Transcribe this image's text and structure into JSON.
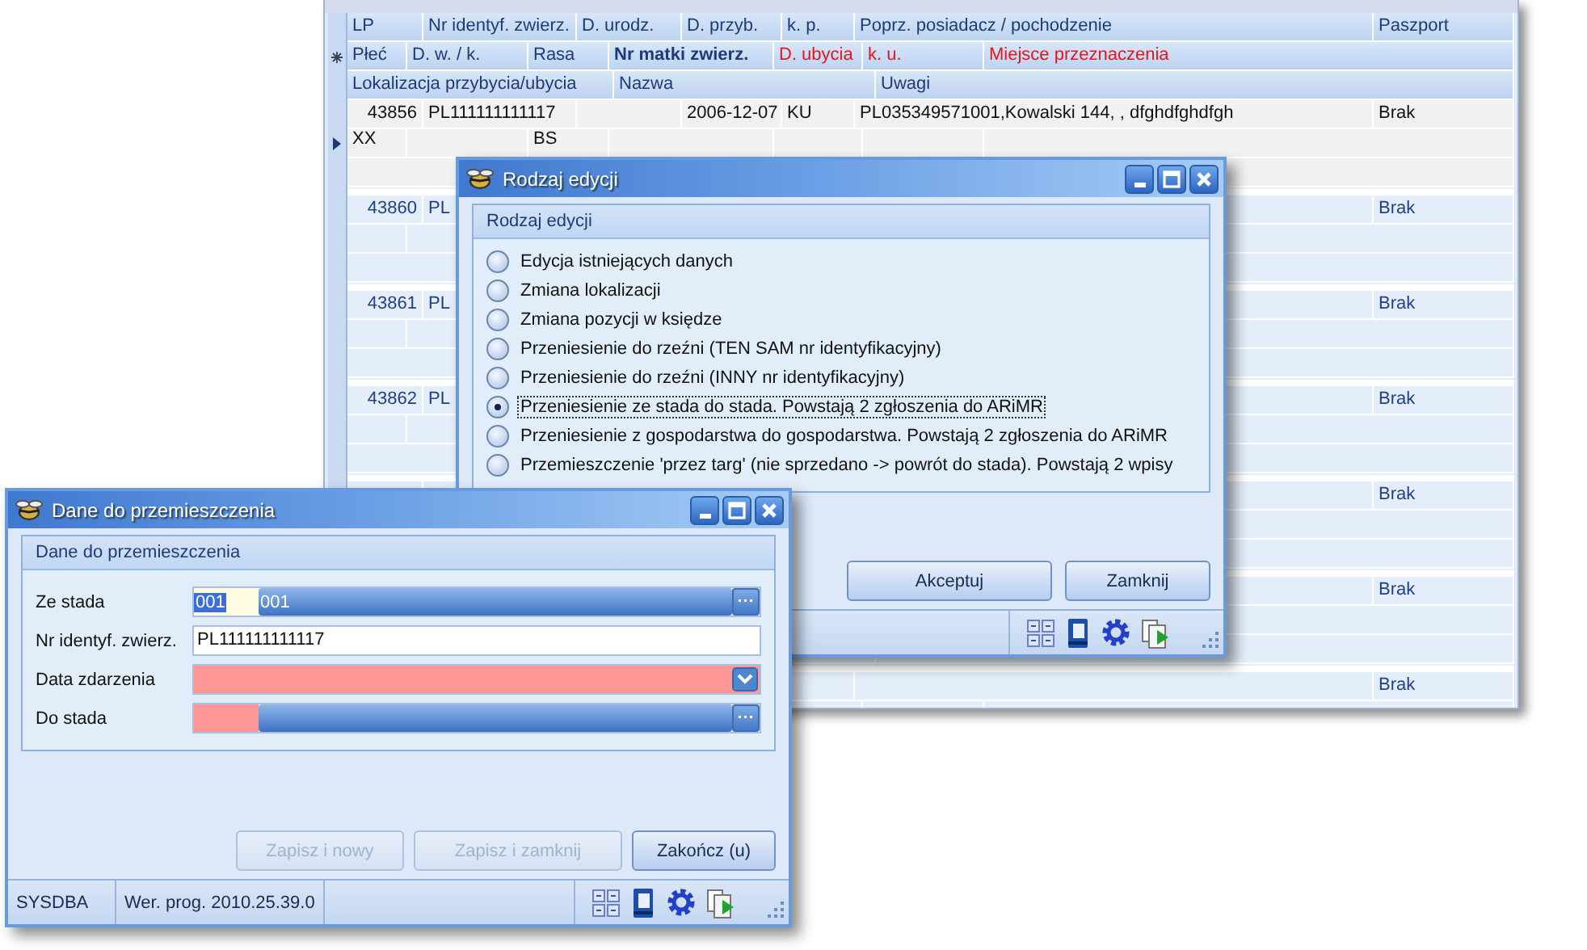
{
  "grid": {
    "header_rows": [
      [
        {
          "label": "LP",
          "kind": "normal"
        },
        {
          "label": "Nr identyf. zwierz.",
          "kind": "normal"
        },
        {
          "label": "D. urodz.",
          "kind": "normal"
        },
        {
          "label": "D. przyb.",
          "kind": "normal"
        },
        {
          "label": "k. p.",
          "kind": "normal"
        },
        {
          "label": "Poprz. posiadacz / pochodzenie",
          "kind": "normal"
        },
        {
          "label": "Paszport",
          "kind": "normal"
        }
      ],
      [
        {
          "label": "Płeć",
          "kind": "normal"
        },
        {
          "label": "D. w. / k.",
          "kind": "normal"
        },
        {
          "label": "Rasa",
          "kind": "normal"
        },
        {
          "label": "Nr matki zwierz.",
          "kind": "bold"
        },
        {
          "label": "D. ubycia",
          "kind": "red"
        },
        {
          "label": "k. u.",
          "kind": "red"
        },
        {
          "label": "Miejsce przeznaczenia",
          "kind": "red"
        }
      ],
      [
        {
          "label": "Lokalizacja przybycia/ubycia",
          "kind": "normal"
        },
        {
          "label": "Nazwa",
          "kind": "normal"
        },
        {
          "label": "Uwagi",
          "kind": "normal"
        }
      ]
    ],
    "records": [
      {
        "selected": true,
        "lp": "43856",
        "nr_identyf": "PL111111111117",
        "d_przyb": "2006-12-07",
        "kp": "KU",
        "poprz": "PL035349571001,Kowalski 144, , dfghdfghdfgh",
        "paszport": "Brak",
        "plec": "XX",
        "rasa": "BS"
      },
      {
        "selected": false,
        "lp": "43860",
        "nr_identyf": "PL",
        "paszport": "Brak"
      },
      {
        "selected": false,
        "lp": "43861",
        "nr_identyf": "PL",
        "paszport": "Brak"
      },
      {
        "selected": false,
        "lp": "43862",
        "nr_identyf": "PL",
        "paszport": "Brak"
      },
      {
        "selected": false,
        "paszport": "Brak"
      },
      {
        "selected": false,
        "paszport": "Brak"
      },
      {
        "selected": false,
        "paszport": "Brak"
      }
    ]
  },
  "edit_dialog": {
    "title": "Rodzaj edycji",
    "group_title": "Rodzaj edycji",
    "options": [
      {
        "label": "Edycja istniejących danych",
        "selected": false
      },
      {
        "label": "Zmiana lokalizacji",
        "selected": false
      },
      {
        "label": "Zmiana pozycji w księdze",
        "selected": false
      },
      {
        "label": "Przeniesienie do rzeźni (TEN SAM nr identyfikacyjny)",
        "selected": false
      },
      {
        "label": "Przeniesienie do rzeźni (INNY nr identyfikacyjny)",
        "selected": false
      },
      {
        "label": "Przeniesienie ze stada do stada. Powstają 2 zgłoszenia do ARiMR",
        "selected": true
      },
      {
        "label": "Przeniesienie z gospodarstwa do gospodarstwa. Powstają 2 zgłoszenia do ARiMR",
        "selected": false
      },
      {
        "label": "Przemieszczenie 'przez targ' (nie sprzedano -> powrót do stada). Powstają 2 wpisy",
        "selected": false
      }
    ],
    "buttons": [
      {
        "label": "Akceptuj",
        "disabled": false
      },
      {
        "label": "Zamknij",
        "disabled": false
      }
    ]
  },
  "move_window": {
    "title": "Dane do przemieszczenia",
    "group_title": "Dane do przemieszczenia",
    "fields": [
      {
        "label": "Ze stada",
        "kind": "lookup",
        "code": "001",
        "name": "001",
        "invalid": false
      },
      {
        "label": "Nr identyf. zwierz.",
        "kind": "text",
        "value": "PL111111111117",
        "invalid": false
      },
      {
        "label": "Data zdarzenia",
        "kind": "date",
        "invalid": true
      },
      {
        "label": "Do stada",
        "kind": "lookup",
        "invalid": true
      }
    ],
    "buttons": [
      {
        "label": "Zapisz i nowy",
        "disabled": true
      },
      {
        "label": "Zapisz i zamknij",
        "disabled": true
      },
      {
        "label": "Zakończ (u)",
        "disabled": false
      }
    ],
    "status_bar": {
      "user": "SYSDBA",
      "version": "Wer. prog. 2010.25.39.0"
    }
  }
}
